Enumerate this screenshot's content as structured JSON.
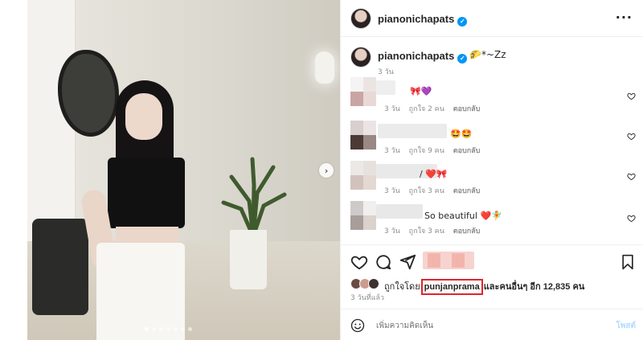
{
  "post": {
    "carousel": {
      "slide_count": 7,
      "active_slide": 1,
      "next_icon": "chevron-right-icon"
    },
    "header": {
      "username": "pianonichapats",
      "verified": true,
      "more_icon": "more-horizontal-icon"
    },
    "caption": {
      "username": "pianonichapats",
      "text": "🌮*~Zz",
      "time": "3 วัน"
    },
    "comments": [
      {
        "emoji": "🎀💜",
        "time": "3 วัน",
        "likes": "ถูกใจ 2 คน",
        "reply": "ตอบกลับ"
      },
      {
        "emoji": "🤩🤩",
        "time": "3 วัน",
        "likes": "ถูกใจ 9 คน",
        "reply": "ตอบกลับ"
      },
      {
        "emoji": "/ ❤️🎀",
        "time": "3 วัน",
        "likes": "ถูกใจ 3 คน",
        "reply": "ตอบกลับ"
      },
      {
        "emoji": "So beautiful ❤️🧚",
        "time": "3 วัน",
        "likes": "ถูกใจ 3 คน",
        "reply": "ตอบกลับ"
      }
    ],
    "actions": {
      "like_icon": "heart-icon",
      "comment_icon": "comment-icon",
      "share_icon": "share-icon",
      "save_icon": "bookmark-icon"
    },
    "likes": {
      "prefix": "ถูกใจโดย",
      "highlighted_user": "punjanprama",
      "suffix": "และคนอื่นๆ อีก 12,835 คน"
    },
    "post_time": "3 วันที่แล้ว",
    "comment_bar": {
      "placeholder": "เพิ่มความคิดเห็น",
      "post_label": "โพสต์",
      "emoji_icon": "smiley-icon"
    }
  },
  "colors": {
    "accent": "#0095f6",
    "highlight": "#e0242d",
    "muted": "#8e8e8e"
  }
}
